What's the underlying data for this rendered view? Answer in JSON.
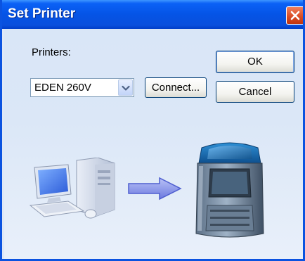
{
  "window": {
    "title": "Set Printer"
  },
  "labels": {
    "printers": "Printers:"
  },
  "printer_select": {
    "value": "EDEN 260V"
  },
  "buttons": {
    "connect": "Connect...",
    "ok": "OK",
    "cancel": "Cancel"
  },
  "illustration": {
    "computer": "computer-icon",
    "arrow": "arrow-right-icon",
    "printer": "3d-printer-icon"
  },
  "colors": {
    "title_bar": "#0554e6",
    "close_button": "#d84a22",
    "arrow": "#7d88e8"
  }
}
